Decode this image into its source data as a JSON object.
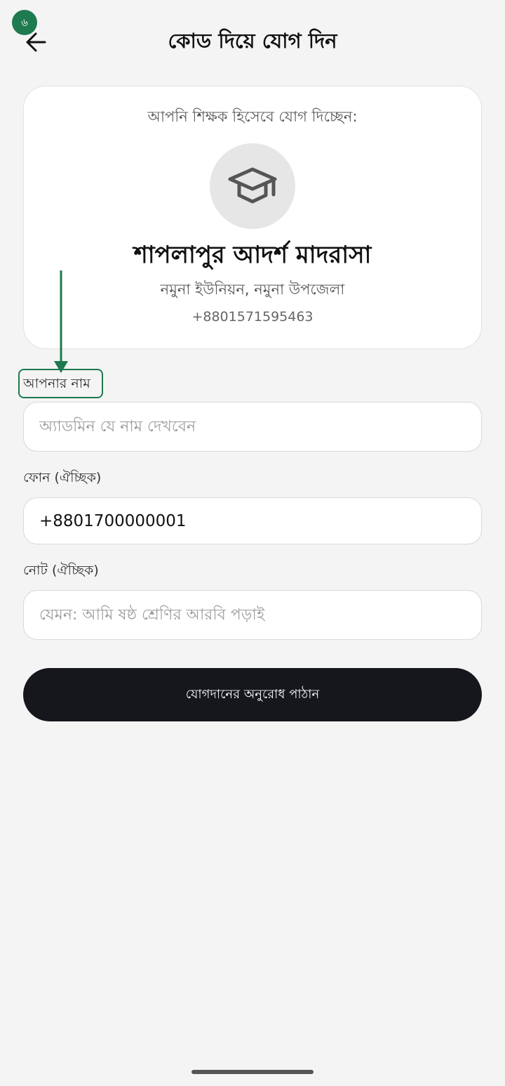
{
  "status_badge": {
    "text": "৬"
  },
  "header": {
    "back_icon": "arrow-left-icon",
    "title": "কোড দিয়ে যোগ দিন"
  },
  "card": {
    "intro": "আপনি শিক্ষক হিসেবে যোগ দিচ্ছেন:",
    "icon": "graduation-cap-icon",
    "institution_name": "শাপলাপুর আদর্শ মাদরাসা",
    "location": "নমুনা ইউনিয়ন, নমুনা উপজেলা",
    "phone": "+8801571595463"
  },
  "form": {
    "name": {
      "label": "আপনার নাম",
      "placeholder": "অ্যাডমিন যে নাম দেখবেন"
    },
    "phone": {
      "label": "ফোন (ঐচ্ছিক)",
      "value": "+8801700000001"
    },
    "note": {
      "label": "নোট (ঐচ্ছিক)",
      "placeholder": "যেমন: আমি ষষ্ঠ শ্রেণির আরবি পড়াই"
    }
  },
  "submit_button": {
    "label": "যোগদানের অনুরোধ পাঠান"
  },
  "colors": {
    "accent": "#1e7a4f",
    "button_background": "#15171c",
    "page_background": "#f4f4f4",
    "card_background": "#ffffff"
  }
}
